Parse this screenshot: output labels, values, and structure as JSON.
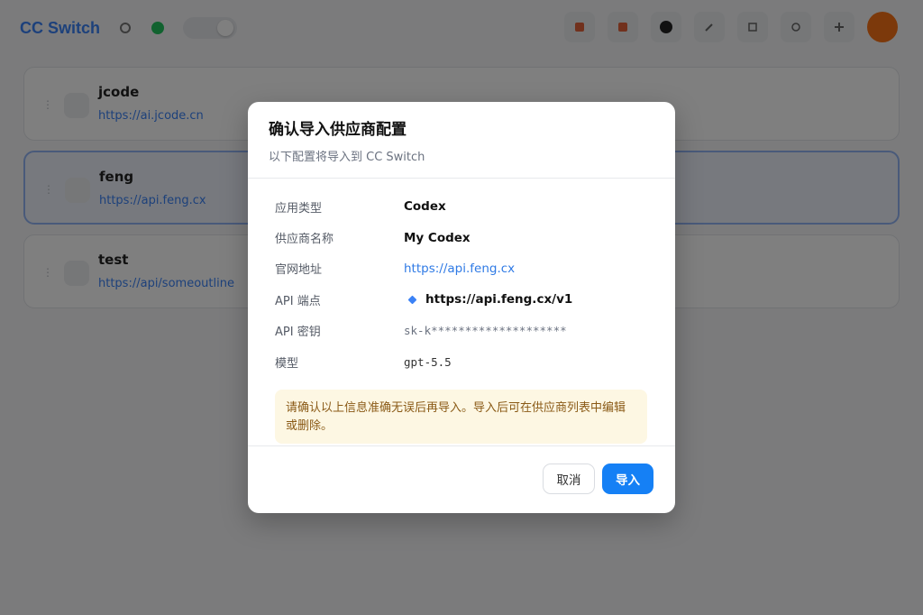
{
  "app": {
    "title": "CC Switch",
    "providers": [
      {
        "name": "jcode",
        "url": "https://ai.jcode.cn",
        "selected": false
      },
      {
        "name": "feng",
        "url": "https://api.feng.cx",
        "selected": true
      },
      {
        "name": "test",
        "url": "https://api/someoutline",
        "selected": false
      }
    ]
  },
  "dialog": {
    "title": "确认导入供应商配置",
    "subtitle": "以下配置将导入到 CC Switch",
    "fields": [
      {
        "label": "应用类型",
        "value": "Codex"
      },
      {
        "label": "供应商名称",
        "value": "My Codex"
      },
      {
        "label": "官网地址",
        "value": "https://api.feng.cx"
      },
      {
        "label": "API 端点",
        "value": "https://api.feng.cx/v1"
      },
      {
        "label": "API 密钥",
        "value": "sk-k********************"
      },
      {
        "label": "模型",
        "value": "gpt-5.5"
      }
    ],
    "notice": "请确认以上信息准确无误后再导入。导入后可在供应商列表中编辑或删除。",
    "cancel_label": "取消",
    "confirm_label": "导入"
  },
  "colors": {
    "accent": "#1580f5",
    "link": "#2f7ae5",
    "notice_bg": "#fdf7e3",
    "notice_text": "#8a5a16",
    "avatar": "#f97316"
  }
}
